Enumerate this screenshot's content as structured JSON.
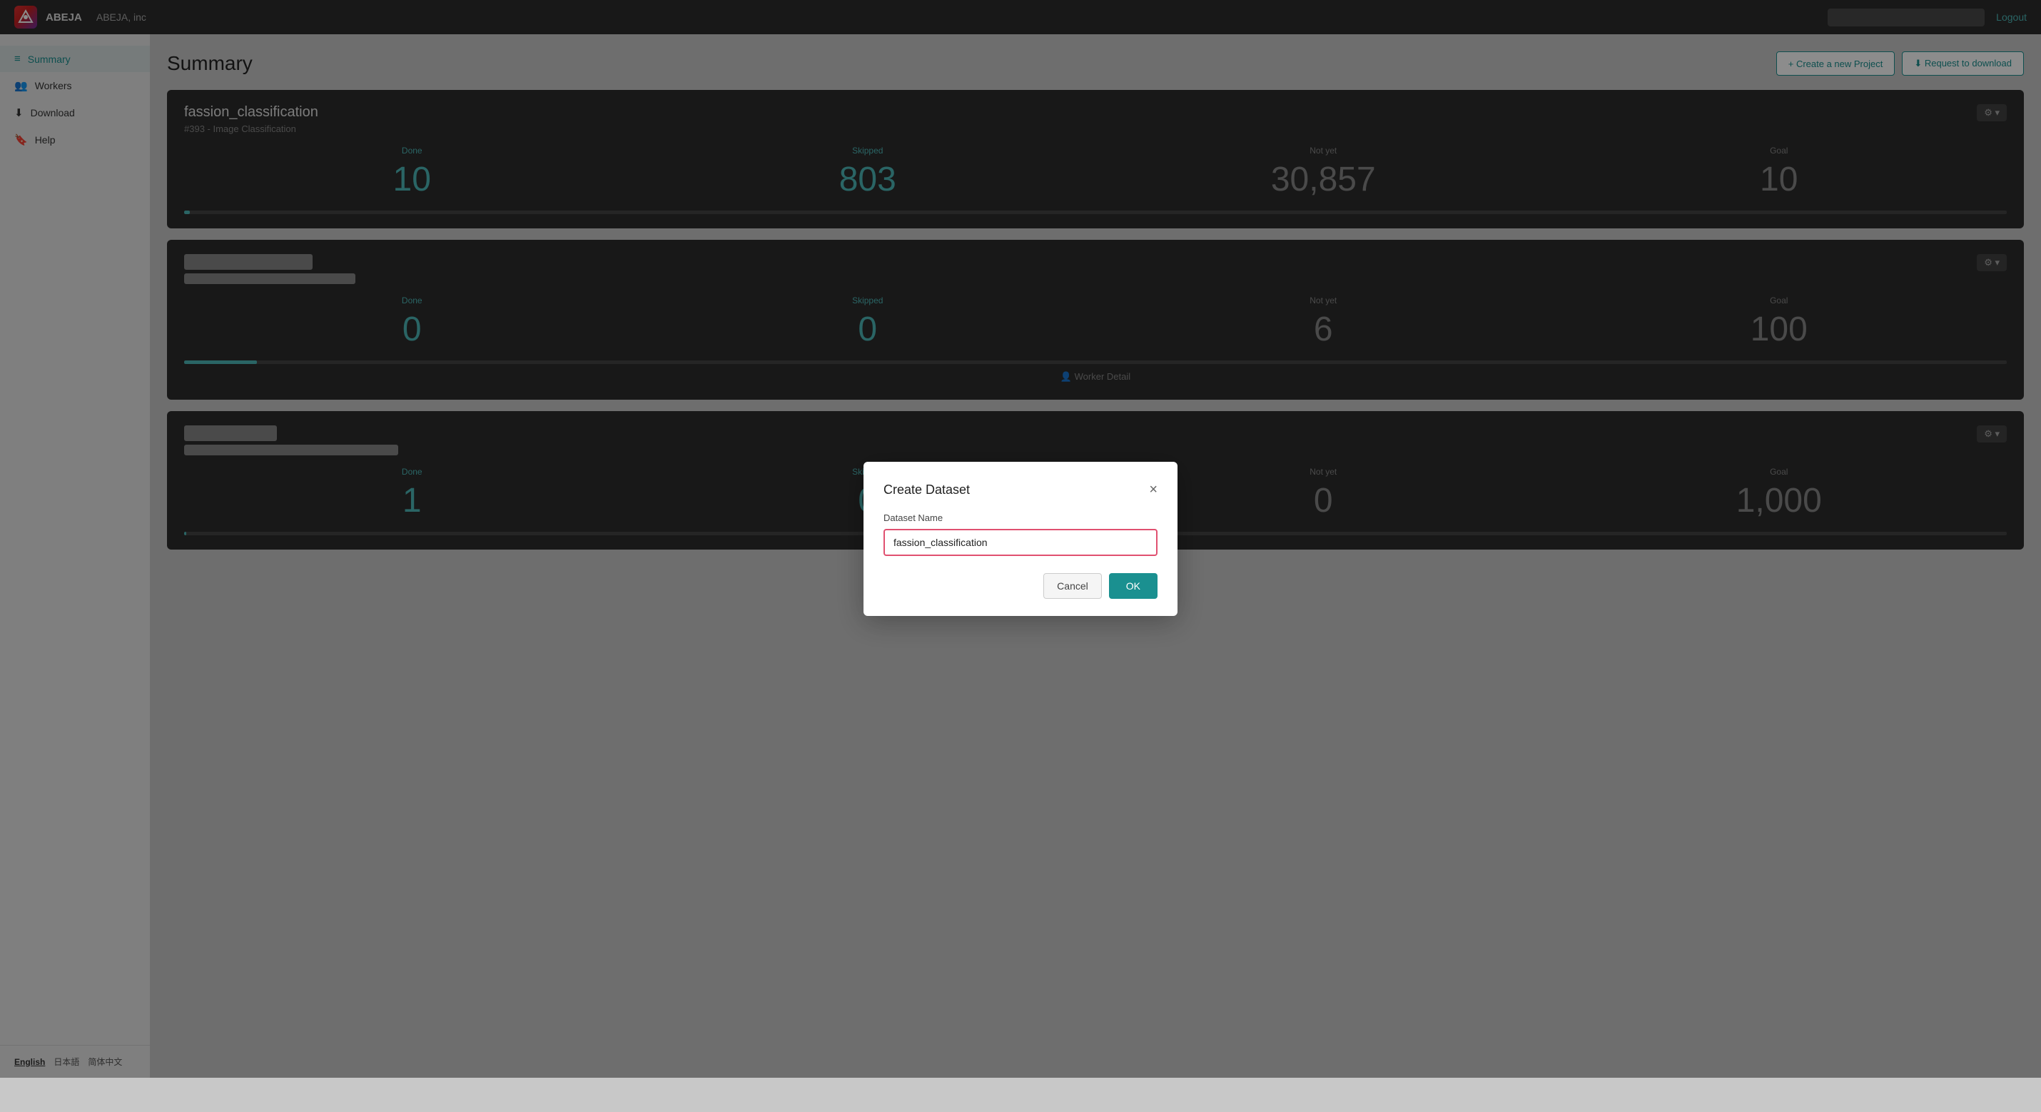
{
  "navbar": {
    "logo_text": "A",
    "brand": "ABEJA",
    "org": "ABEJA, inc",
    "search_placeholder": "",
    "logout_label": "Logout"
  },
  "sidebar": {
    "items": [
      {
        "id": "summary",
        "icon": "≡",
        "label": "Summary",
        "active": true
      },
      {
        "id": "workers",
        "icon": "👥",
        "label": "Workers",
        "active": false
      },
      {
        "id": "download",
        "icon": "⬇",
        "label": "Download",
        "active": false
      },
      {
        "id": "help",
        "icon": "🔖",
        "label": "Help",
        "active": false
      }
    ],
    "languages": [
      {
        "code": "en",
        "label": "English",
        "active": true
      },
      {
        "code": "ja",
        "label": "日本語",
        "active": false
      },
      {
        "code": "zh",
        "label": "简体中文",
        "active": false
      }
    ]
  },
  "page": {
    "title": "Summary",
    "actions": {
      "create_project": "+ Create a new Project",
      "request_download": "⬇ Request to download"
    }
  },
  "projects": [
    {
      "id": 1,
      "name": "fassion_classification",
      "meta": "#393 - Image Classification",
      "stats": {
        "done_label": "Done",
        "done_value": "10",
        "skipped_label": "Skipped",
        "skipped_value": "803",
        "notyet_label": "Not yet",
        "notyet_value": "30,857",
        "goal_label": "Goal",
        "goal_value": "10"
      },
      "progress_pct": 0.03,
      "blurred": false
    },
    {
      "id": 2,
      "name": "██████ ████████",
      "meta": "██████████████████████████",
      "stats": {
        "done_label": "Done",
        "done_value": "0",
        "skipped_label": "Skipped",
        "skipped_value": "0",
        "notyet_label": "Not yet",
        "notyet_value": "6",
        "goal_label": "Goal",
        "goal_value": "100"
      },
      "progress_pct": 0,
      "blurred": true,
      "show_worker_detail": true
    },
    {
      "id": 3,
      "name": "████████",
      "meta": "██████████████████████████████████████",
      "stats": {
        "done_label": "Done",
        "done_value": "1",
        "skipped_label": "Skipped",
        "skipped_value": "0",
        "notyet_label": "Not yet",
        "notyet_value": "0",
        "goal_label": "Goal",
        "goal_value": "1,000"
      },
      "progress_pct": 0.01,
      "blurred": true
    }
  ],
  "modal": {
    "title": "Create Dataset",
    "label": "Dataset Name",
    "input_value": "fassion_classification",
    "cancel_label": "Cancel",
    "ok_label": "OK"
  }
}
